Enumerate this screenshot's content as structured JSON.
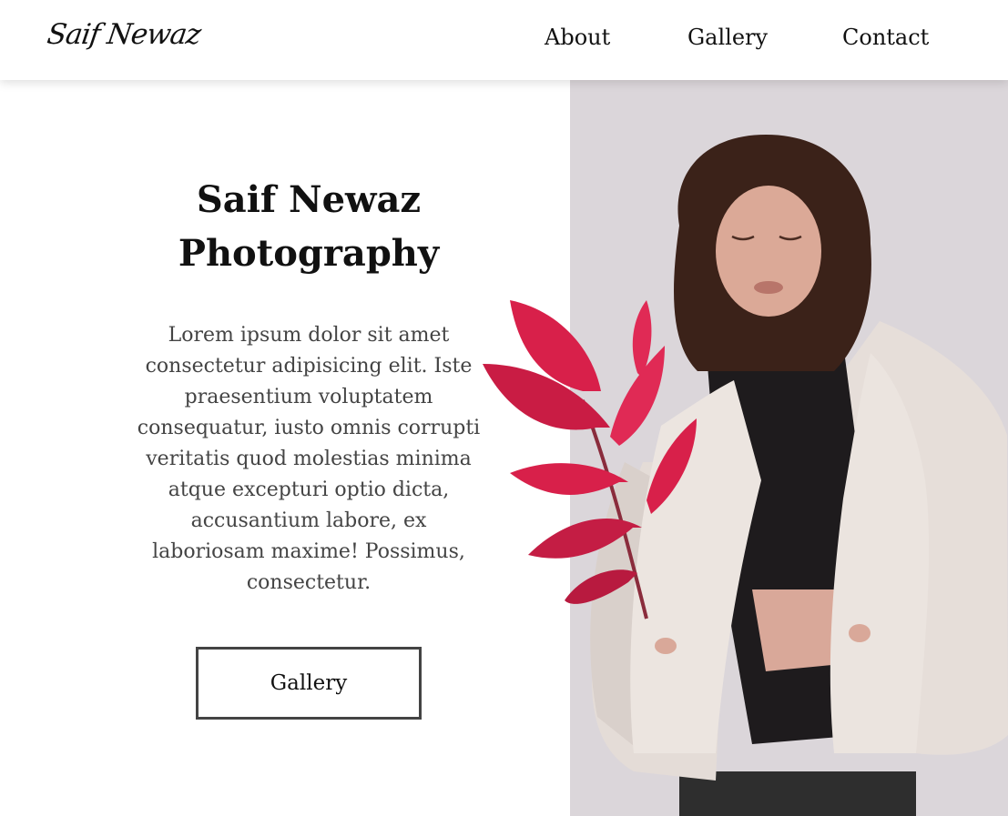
{
  "nav": {
    "logo": "Saif Newaz",
    "links": [
      "About",
      "Gallery",
      "Contact"
    ]
  },
  "hero": {
    "title_line1": "Saif Newaz",
    "title_line2": "Photography",
    "paragraph": "Lorem ipsum dolor sit amet consectetur adipisicing elit. Iste praesentium voluptatem consequatur, iusto omnis corrupti veritatis quod molestias minima atque excepturi optio dicta, accusantium labore, ex laboriosam maxime! Possimus, consectetur.",
    "button_label": "Gallery"
  },
  "colors": {
    "accent_pink": "#d8204a",
    "photo_background": "#dcd8dc",
    "button_border": "#444444"
  },
  "icons": {
    "photo": "woman-in-fur-coat-photo",
    "plant": "red-leaf-plant"
  }
}
